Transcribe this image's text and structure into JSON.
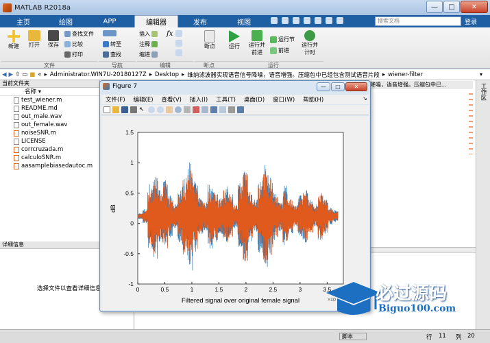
{
  "window": {
    "title": "MATLAB R2018a",
    "min": "—",
    "max": "□",
    "close": "✕"
  },
  "tabs": [
    {
      "label": "主页"
    },
    {
      "label": "绘图"
    },
    {
      "label": "APP"
    },
    {
      "label": "编辑器"
    },
    {
      "label": "发布"
    },
    {
      "label": "视图"
    }
  ],
  "search": {
    "placeholder": "搜索文档",
    "login": "登录"
  },
  "ribbon": {
    "file": {
      "new": "新建",
      "open": "打开",
      "save": "保存",
      "find_files": "查找文件",
      "compare": "比较",
      "print": "打印",
      "section": "文件"
    },
    "nav": {
      "goto": "转至",
      "find": "查找",
      "section": "导航"
    },
    "edit": {
      "insert": "插入",
      "comment": "注释",
      "indent": "缩进",
      "fx": "fx",
      "section": "编辑"
    },
    "breakpoints": {
      "label": "断点",
      "section": "断点"
    },
    "run": {
      "run": "运行",
      "run_advance": "运行并\n前进",
      "run_section": "运行节",
      "advance": "前进",
      "run_time": "运行并\n计时",
      "section": "运行"
    }
  },
  "address": {
    "path": [
      "«",
      "Administrator.WIN7U-20180127Z",
      "Desktop",
      "维纳滤波器实现语音信号降噪，语音增强。压缩包中已经包含测试语音片段",
      "wiener-filter"
    ]
  },
  "left_panel": {
    "header": "当前文件夹",
    "col": "名称",
    "files": [
      "test_wiener.m",
      "README.md",
      "out_male.wav",
      "out_female.wav",
      "noiseSNR.m",
      "LICENSE",
      "corrcruzada.m",
      "calculoSNR.m",
      "aasamplebiasedautoc.m"
    ],
    "details_header": "详细信息",
    "details_msg": "选择文件以查看详细信息"
  },
  "right_side": {
    "text": "降噪，语音增强。压缩包中已...",
    "workspace": "工作区"
  },
  "figure": {
    "title": "Figure 7",
    "menu": [
      "文件(F)",
      "编辑(E)",
      "查看(V)",
      "插入(I)",
      "工具(T)",
      "桌面(D)",
      "窗口(W)",
      "帮助(H)"
    ]
  },
  "chart_data": {
    "type": "line",
    "title": "",
    "xlabel": "Filtered signal over original female signal",
    "ylabel": "dB",
    "xlim": [
      0,
      3.8
    ],
    "ylim": [
      -1,
      1.5
    ],
    "x_ticks": [
      "0",
      "0.5",
      "1",
      "1.5",
      "2",
      "2.5",
      "3",
      "3.5"
    ],
    "y_ticks": [
      "1.5",
      "1",
      "0.5",
      "0",
      "-0.5",
      "-1"
    ],
    "x_exponent": "×10",
    "series": [
      {
        "color": "#2b7bba",
        "envelope": [
          0.05,
          0.12,
          0.55,
          0.7,
          0.45,
          0.6,
          0.35,
          0.2,
          0.5,
          0.65,
          0.9,
          0.6,
          0.3,
          0.25,
          0.55,
          0.45,
          0.3,
          0.5,
          0.4,
          0.2,
          0.55,
          0.8,
          0.45,
          0.3,
          0.6,
          0.85,
          0.7,
          0.4,
          0.25,
          0.5,
          0.3,
          0.2,
          0.35,
          0.45,
          0.3,
          0.2,
          0.4,
          0.3,
          0.15,
          0.1
        ]
      },
      {
        "color": "#e05a1e",
        "envelope": [
          0.04,
          0.1,
          0.5,
          0.65,
          0.4,
          0.55,
          0.3,
          0.18,
          0.45,
          0.6,
          0.85,
          0.55,
          0.28,
          0.22,
          0.5,
          0.4,
          0.28,
          0.45,
          0.36,
          0.18,
          0.5,
          0.75,
          0.4,
          0.28,
          0.55,
          0.8,
          0.65,
          0.36,
          0.22,
          0.45,
          0.28,
          0.18,
          0.32,
          0.4,
          0.28,
          0.18,
          0.36,
          0.28,
          0.12,
          0.08
        ]
      }
    ]
  },
  "status": {
    "script": "脚本",
    "row_label": "行",
    "row": "11",
    "col_label": "列",
    "col": "20"
  },
  "watermark": {
    "brand": "必过源码",
    "url": "Biguo100.com"
  }
}
